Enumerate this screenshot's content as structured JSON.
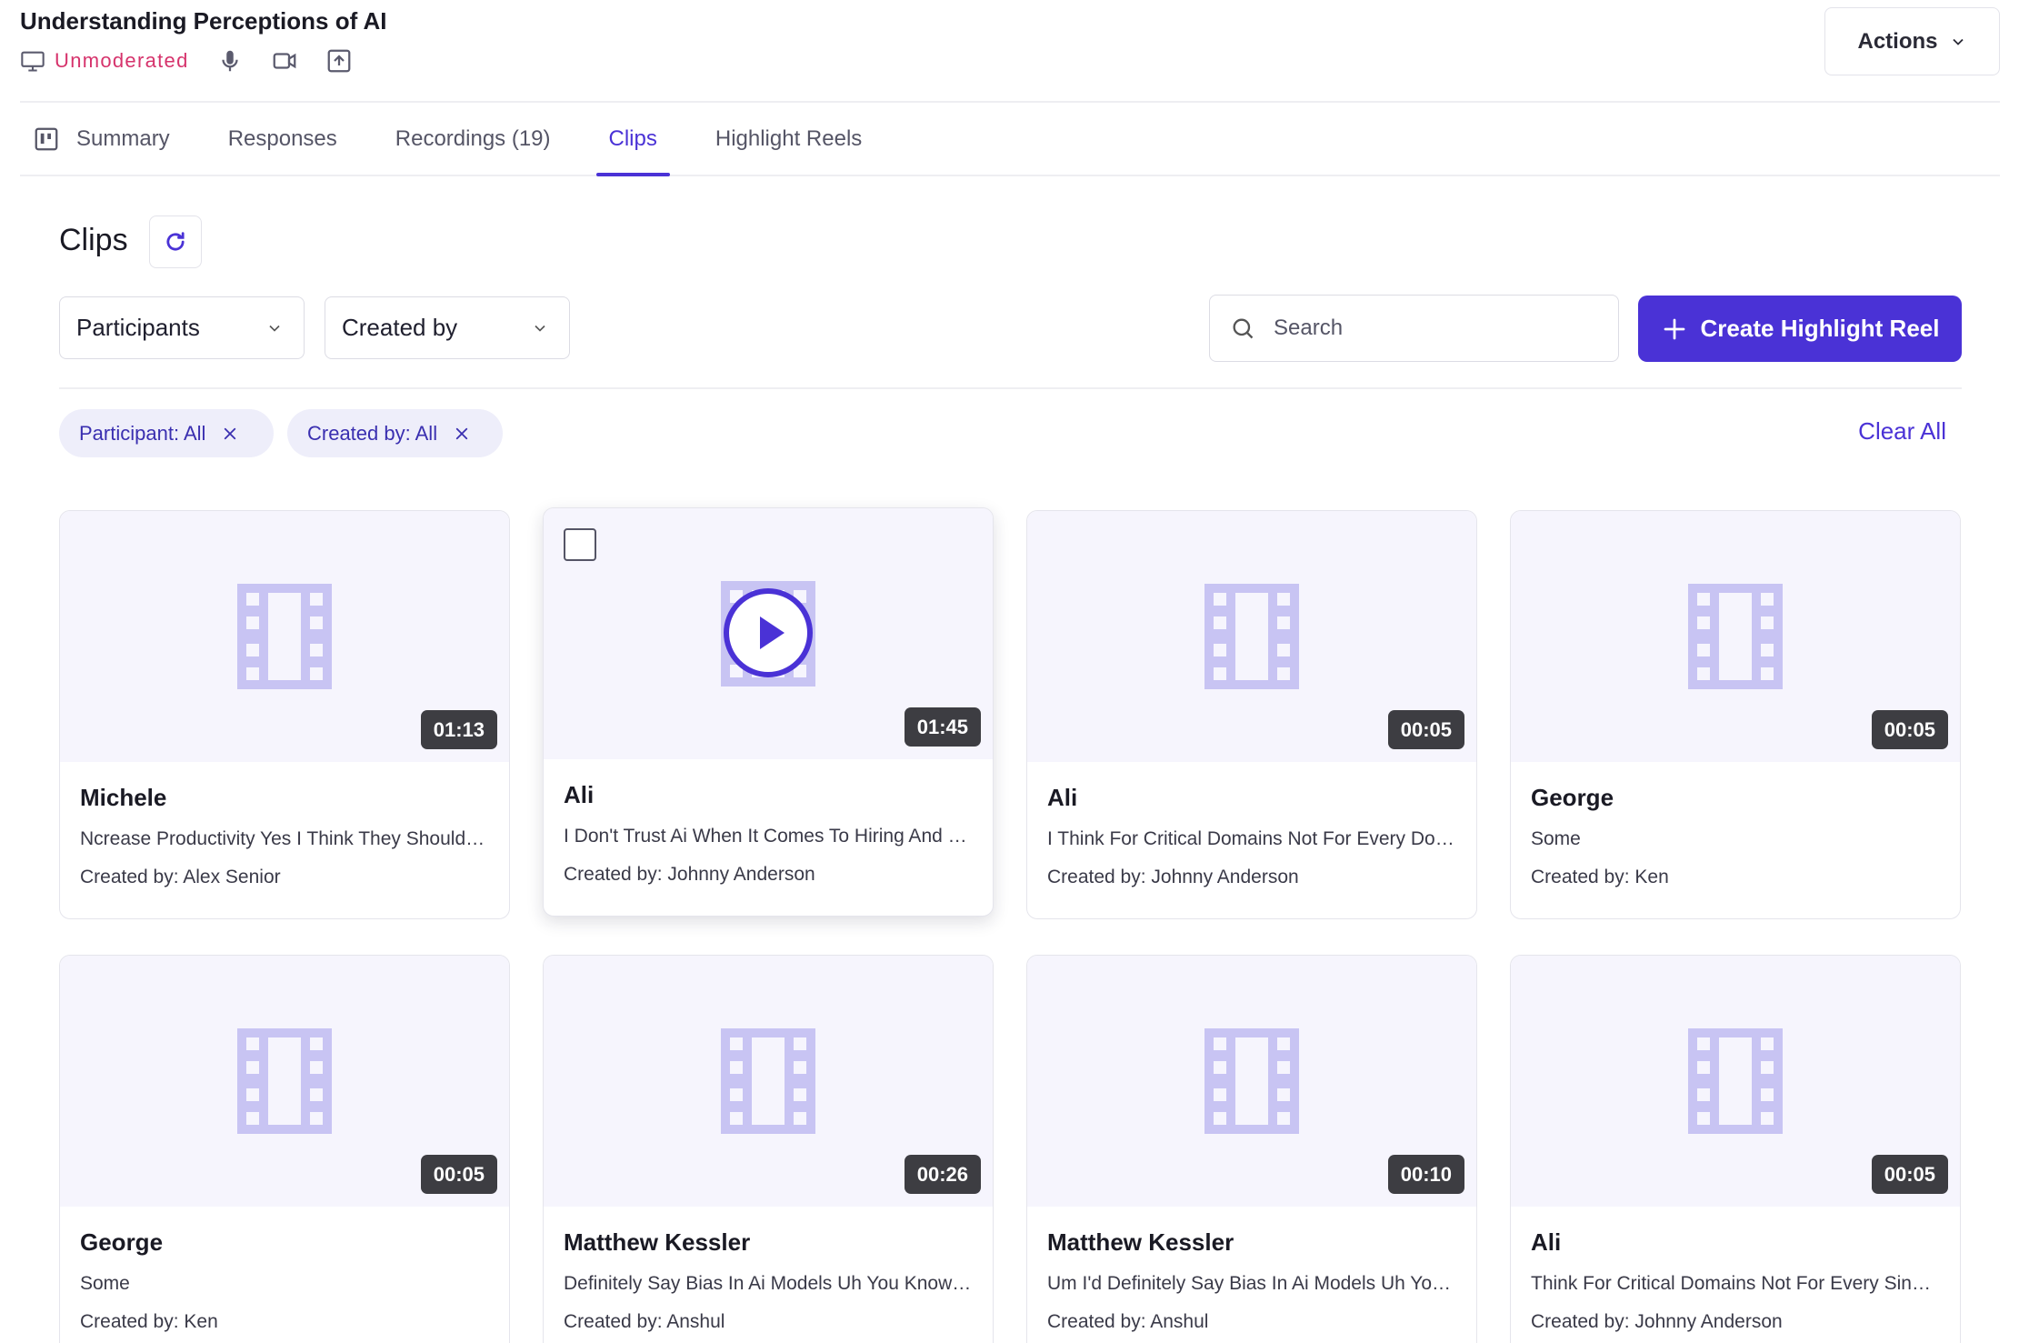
{
  "header": {
    "title": "Understanding Perceptions of AI",
    "mode": "Unmoderated",
    "actions_label": "Actions"
  },
  "tabs": [
    {
      "label": "Summary",
      "icon": "board-icon"
    },
    {
      "label": "Responses"
    },
    {
      "label": "Recordings (19)"
    },
    {
      "label": "Clips",
      "active": true
    },
    {
      "label": "Highlight Reels"
    }
  ],
  "section": {
    "title": "Clips"
  },
  "filters": {
    "participants_label": "Participants",
    "created_by_label": "Created by",
    "search_placeholder": "Search",
    "create_button_label": "Create Highlight Reel",
    "chips": [
      {
        "label": "Participant: All"
      },
      {
        "label": "Created by: All"
      }
    ],
    "clear_all_label": "Clear All"
  },
  "clips": [
    {
      "name": "Michele",
      "duration": "01:13",
      "description": "Ncrease Productivity Yes I Think They Should Be Used In Areas Where...",
      "creator": "Created by: Alex Senior"
    },
    {
      "name": "Ali",
      "duration": "01:45",
      "description": "I Don't Trust Ai When It Comes To Hiring And Recruitment Decisions",
      "creator": "Created by: Johnny Anderson",
      "hovered": true
    },
    {
      "name": "Ali",
      "duration": "00:05",
      "description": "I Think For Critical Domains Not For Every Domain",
      "creator": "Created by: Johnny Anderson"
    },
    {
      "name": "George",
      "duration": "00:05",
      "description": "Some",
      "creator": "Created by: Ken"
    },
    {
      "name": "George",
      "duration": "00:05",
      "description": "Some",
      "creator": "Created by: Ken"
    },
    {
      "name": "Matthew Kessler",
      "duration": "00:26",
      "description": "Definitely Say Bias In Ai Models Uh You Know Is A Concern",
      "creator": "Created by: Anshul"
    },
    {
      "name": "Matthew Kessler",
      "duration": "00:10",
      "description": "Um I'd Definitely Say Bias In Ai Models Uh You Know",
      "creator": "Created by: Anshul"
    },
    {
      "name": "Ali",
      "duration": "00:05",
      "description": "Think For Critical Domains Not For Every Single Domain",
      "creator": "Created by: Johnny Anderson"
    }
  ],
  "colors": {
    "accent": "#4a32d6",
    "mode_text": "#d6336c",
    "thumb_bg": "#f6f5fd",
    "film_icon": "#c8c4f3",
    "duration_badge": "#3d3d42"
  }
}
